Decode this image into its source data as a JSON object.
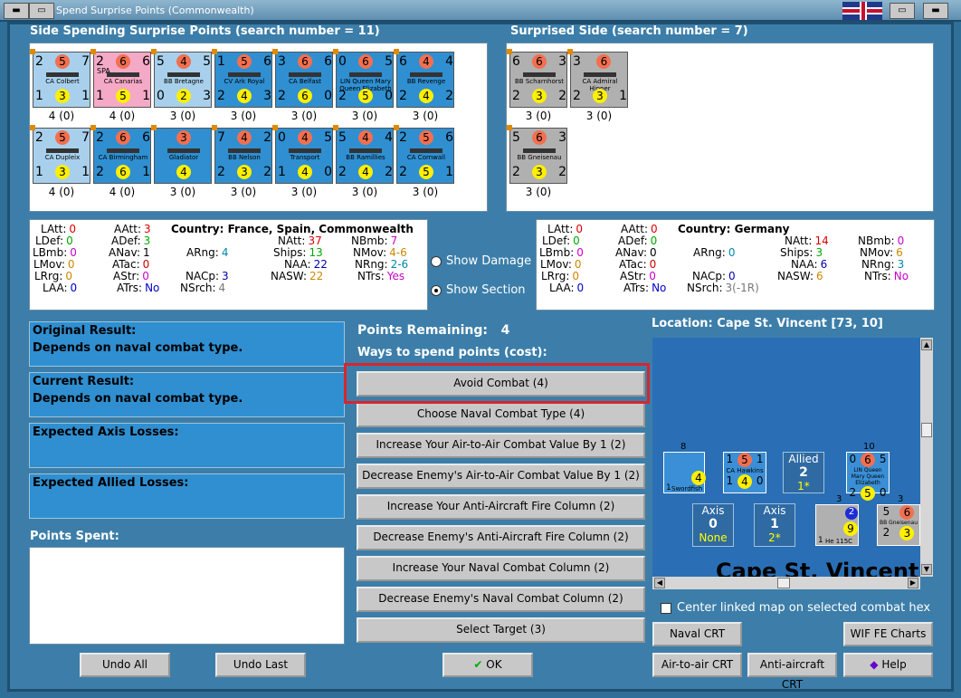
{
  "window": {
    "title": "Spend Surprise Points (Commonwealth)"
  },
  "left_header": "Side Spending Surprise Points (search number = 11)",
  "right_header": "Surprised Side (search number = 7)",
  "left_ships": [
    {
      "name": "CA Colbert",
      "top": [
        "2",
        "5",
        "7"
      ],
      "bot": [
        "1",
        "3",
        "1"
      ],
      "count": "4 (0)",
      "color": "lblue"
    },
    {
      "name": "CA Canarias",
      "top": [
        "2",
        "6",
        "6"
      ],
      "bot": [
        "1",
        "5",
        "1"
      ],
      "count": "4 (0)",
      "color": "pink",
      "tag": "SPA"
    },
    {
      "name": "BB Bretagne",
      "top": [
        "5",
        "4",
        "5"
      ],
      "bot": [
        "0",
        "2",
        "3"
      ],
      "count": "3 (0)",
      "color": "lblue"
    },
    {
      "name": "CV Ark Royal",
      "top": [
        "1",
        "5",
        "6"
      ],
      "bot": [
        "2",
        "4",
        "3"
      ],
      "count": "3 (0)",
      "color": "dblue"
    },
    {
      "name": "CA Belfast",
      "top": [
        "3",
        "6",
        "6"
      ],
      "bot": [
        "2",
        "6",
        "0"
      ],
      "count": "3 (0)",
      "color": "dblue"
    },
    {
      "name": "LIN Queen Mary Queen Elizabeth",
      "top": [
        "0",
        "6",
        "5"
      ],
      "bot": [
        "2",
        "5",
        "0"
      ],
      "count": "3 (0)",
      "color": "dblue"
    },
    {
      "name": "BB Revenge",
      "top": [
        "6",
        "4",
        "4"
      ],
      "bot": [
        "2",
        "4",
        "2"
      ],
      "count": "3 (0)",
      "color": "dblue"
    },
    {
      "name": "CA Dupleix",
      "top": [
        "2",
        "5",
        "7"
      ],
      "bot": [
        "1",
        "3",
        "1"
      ],
      "count": "4 (0)",
      "color": "lblue"
    },
    {
      "name": "CA Birmingham",
      "top": [
        "2",
        "6",
        "6"
      ],
      "bot": [
        "2",
        "6",
        "1"
      ],
      "count": "4 (0)",
      "color": "dblue"
    },
    {
      "name": "Gladiator",
      "top": [
        "",
        "3",
        ""
      ],
      "bot": [
        "",
        "4",
        ""
      ],
      "count": "3 (0)",
      "color": "dblue"
    },
    {
      "name": "BB Nelson",
      "top": [
        "7",
        "4",
        "2"
      ],
      "bot": [
        "2",
        "3",
        "2"
      ],
      "count": "3 (0)",
      "color": "dblue"
    },
    {
      "name": "Transport",
      "top": [
        "0",
        "4",
        "5"
      ],
      "bot": [
        "1",
        "4",
        "0"
      ],
      "count": "3 (0)",
      "color": "dblue"
    },
    {
      "name": "BB Ramillies",
      "top": [
        "5",
        "4",
        "4"
      ],
      "bot": [
        "2",
        "4",
        "2"
      ],
      "count": "3 (0)",
      "color": "dblue"
    },
    {
      "name": "CA Cornwall",
      "top": [
        "2",
        "5",
        "6"
      ],
      "bot": [
        "2",
        "5",
        "1"
      ],
      "count": "3 (0)",
      "color": "dblue"
    }
  ],
  "right_ships": [
    {
      "name": "BB Scharnhorst",
      "top": [
        "6",
        "6",
        "3"
      ],
      "bot": [
        "2",
        "3",
        "2"
      ],
      "count": "3 (0)"
    },
    {
      "name": "CA Admiral Hipper",
      "top": [
        "3",
        "6",
        ""
      ],
      "bot": [
        "2",
        "3",
        "1"
      ],
      "count": "3 (0)"
    },
    {
      "name": "BB Gneisenau",
      "top": [
        "5",
        "6",
        "3"
      ],
      "bot": [
        "2",
        "3",
        "2"
      ],
      "count": "3 (0)"
    }
  ],
  "left_stats": {
    "country_label": "Country:",
    "country": "France, Spain, Commonwealth",
    "LAtt": "0",
    "LDef": "0",
    "LBmb": "0",
    "LMov": "0",
    "LRrg": "0",
    "LAA": "0",
    "AAtt": "3",
    "ADef": "3",
    "ANav": "1",
    "ATac": "0",
    "AStr": "0",
    "ATrs": "No",
    "ARng": "4",
    "NACp": "3",
    "NSrch": "4",
    "NAtt": "37",
    "Ships": "13",
    "NAA": "22",
    "NASW": "22",
    "NBmb": "7",
    "NMov": "4-6",
    "NRng": "2-6",
    "NTrs": "Yes"
  },
  "right_stats": {
    "country_label": "Country:",
    "country": "Germany",
    "LAtt": "0",
    "LDef": "0",
    "LBmb": "0",
    "LMov": "0",
    "LRrg": "0",
    "LAA": "0",
    "AAtt": "0",
    "ADef": "0",
    "ANav": "0",
    "ATac": "0",
    "AStr": "0",
    "ATrs": "No",
    "ARng": "0",
    "NACp": "0",
    "NSrch": "3(-1R)",
    "NAtt": "14",
    "Ships": "3",
    "NAA": "6",
    "NASW": "6",
    "NBmb": "0",
    "NMov": "6",
    "NRng": "3",
    "NTrs": "No"
  },
  "options": {
    "show_damage": "Show Damage",
    "show_section": "Show Section"
  },
  "results": {
    "original_label": "Original Result:",
    "original_value": "Depends on naval combat type.",
    "current_label": "Current Result:",
    "current_value": "Depends on naval combat type.",
    "axis_losses_label": "Expected Axis Losses:",
    "allied_losses_label": "Expected Allied Losses:",
    "points_spent_label": "Points Spent:"
  },
  "points": {
    "label": "Points Remaining:",
    "value": "4",
    "ways_label": "Ways to spend points (cost):"
  },
  "actions": [
    "Avoid Combat (4)",
    "Choose Naval Combat Type (4)",
    "Increase Your Air-to-Air Combat Value By 1 (2)",
    "Decrease Enemy's Air-to-Air Combat Value By 1 (2)",
    "Increase Your Anti-Aircraft Fire Column (2)",
    "Decrease Enemy's Anti-Aircraft Fire Column (2)",
    "Increase Your Naval Combat Column (2)",
    "Decrease Enemy's Naval Combat Column (2)",
    "Select Target (3)"
  ],
  "location": {
    "label": "Location: Cape St. Vincent [73, 10]",
    "map_name": "Cape St. Vincent"
  },
  "map": {
    "swordfish": "Swordfish",
    "swordfish_top": "8",
    "swordfish_bot": [
      "1",
      "4",
      "1"
    ],
    "hawkins": "CA Hawkins",
    "hawkins_top": [
      "1",
      "5",
      "1"
    ],
    "hawkins_bot": [
      "1",
      "4",
      "0"
    ],
    "allied_label": "Allied",
    "allied_num": "2",
    "allied_sub": "1*",
    "axis1_label": "Axis",
    "axis1_num": "0",
    "axis1_sub": "None",
    "axis2_label": "Axis",
    "axis2_num": "1",
    "axis2_sub": "2*",
    "he115": "He 115C",
    "he115_top": "3",
    "he115_num": "2",
    "he115_bot": [
      "1",
      "9"
    ],
    "qm_top": "10",
    "qm_nums": [
      "0",
      "6",
      "5"
    ],
    "qm_bot": [
      "2",
      "5",
      "0"
    ],
    "qm_name": "LIN Queen Mary Queen Elizabeth",
    "bg_top": "3",
    "bg_nums": [
      "5",
      "6"
    ],
    "bg_bot": [
      "2",
      "3"
    ],
    "bg_name": "BB Gneisenau"
  },
  "center_checkbox": "Center linked map on selected combat hex",
  "buttons": {
    "undo_all": "Undo All",
    "undo_last": "Undo Last",
    "ok": "OK",
    "naval_crt": "Naval CRT",
    "wif_charts": "WIF FE Charts",
    "air_crt": "Air-to-air CRT",
    "aa_crt": "Anti-aircraft CRT",
    "help": "Help"
  },
  "colors": {
    "accent_red": "#d7262e",
    "panel_blue": "#2f8fd1",
    "bg_blue": "#3c7ea9"
  }
}
